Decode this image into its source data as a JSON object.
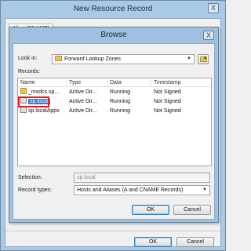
{
  "outer_window": {
    "title": "New Resource Record",
    "close_label": "X",
    "tab_label": "Alias (CNAME)",
    "ok_label": "OK",
    "cancel_label": "Cancel"
  },
  "browse": {
    "title": "Browse",
    "close_label": "X",
    "look_in_label": "Look in:",
    "look_in_value": "Forward Lookup Zones",
    "records_label": "Records:",
    "columns": [
      "Name",
      "Type",
      "Data",
      "Timestamp"
    ],
    "records": [
      {
        "name": "_msdcs.sp...",
        "type": "Active Dir...",
        "data": "Running",
        "timestamp": "Not Signed",
        "icon": "folder-icon"
      },
      {
        "name": "sp.local",
        "type": "Active Dir...",
        "data": "Running",
        "timestamp": "Not Signed",
        "icon": "zone-icon",
        "selected": true
      },
      {
        "name": "sp.localApps",
        "type": "Active Dir...",
        "data": "Running",
        "timestamp": "Not Signed",
        "icon": "zone-icon"
      }
    ],
    "selection_label": "Selection:",
    "selection_value": "sp.local",
    "record_types_label": "Record types:",
    "record_types_value": "Hosts and Aliases (A and CNAME Records)",
    "ok_label": "OK",
    "cancel_label": "Cancel"
  },
  "colors": {
    "title_bar": "#a9c9e6",
    "selection": "#3a79cc",
    "highlight": "#e21b1b"
  }
}
